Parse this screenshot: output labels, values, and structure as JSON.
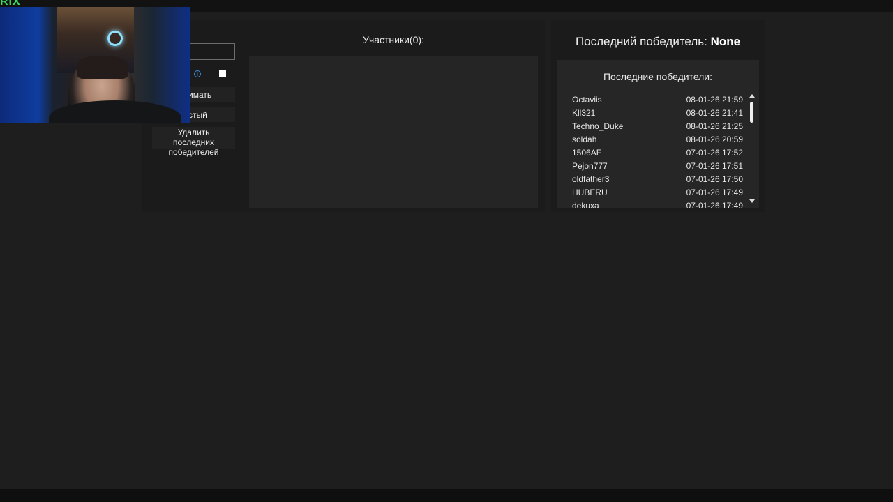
{
  "app": {
    "logo_text": "RIX"
  },
  "left_panel": {
    "name_input_value": "",
    "accept_label": "имать",
    "clear_label": "стый",
    "delete_winners_label": "Удалить последних победителей"
  },
  "participants": {
    "title": "Участники(0):",
    "items": []
  },
  "last_winner": {
    "label": "Последний победитель:",
    "value": "None"
  },
  "recent_winners": {
    "title": "Последние победители:",
    "items": [
      {
        "name": "Octaviis",
        "date": "08-01-26 21:59"
      },
      {
        "name": "Kll321",
        "date": "08-01-26 21:41"
      },
      {
        "name": "Techno_Duke",
        "date": "08-01-26 21:25"
      },
      {
        "name": "soldah",
        "date": "08-01-26 20:59"
      },
      {
        "name": "1506AF",
        "date": "07-01-26 17:52"
      },
      {
        "name": "Pejon777",
        "date": "07-01-26 17:51"
      },
      {
        "name": "oldfather3",
        "date": "07-01-26 17:50"
      },
      {
        "name": "HUBERU",
        "date": "07-01-26 17:49"
      },
      {
        "name": "dekuxa",
        "date": "07-01-26 17:49"
      }
    ]
  },
  "colors": {
    "background": "#1e1e1e",
    "panel": "#1b1b1b",
    "accent_info": "#3d8fe0",
    "logo": "#39e05f"
  },
  "icons": {
    "info": "info-circle-icon",
    "scroll_up": "scroll-up-arrow-icon",
    "scroll_down": "scroll-down-arrow-icon"
  }
}
